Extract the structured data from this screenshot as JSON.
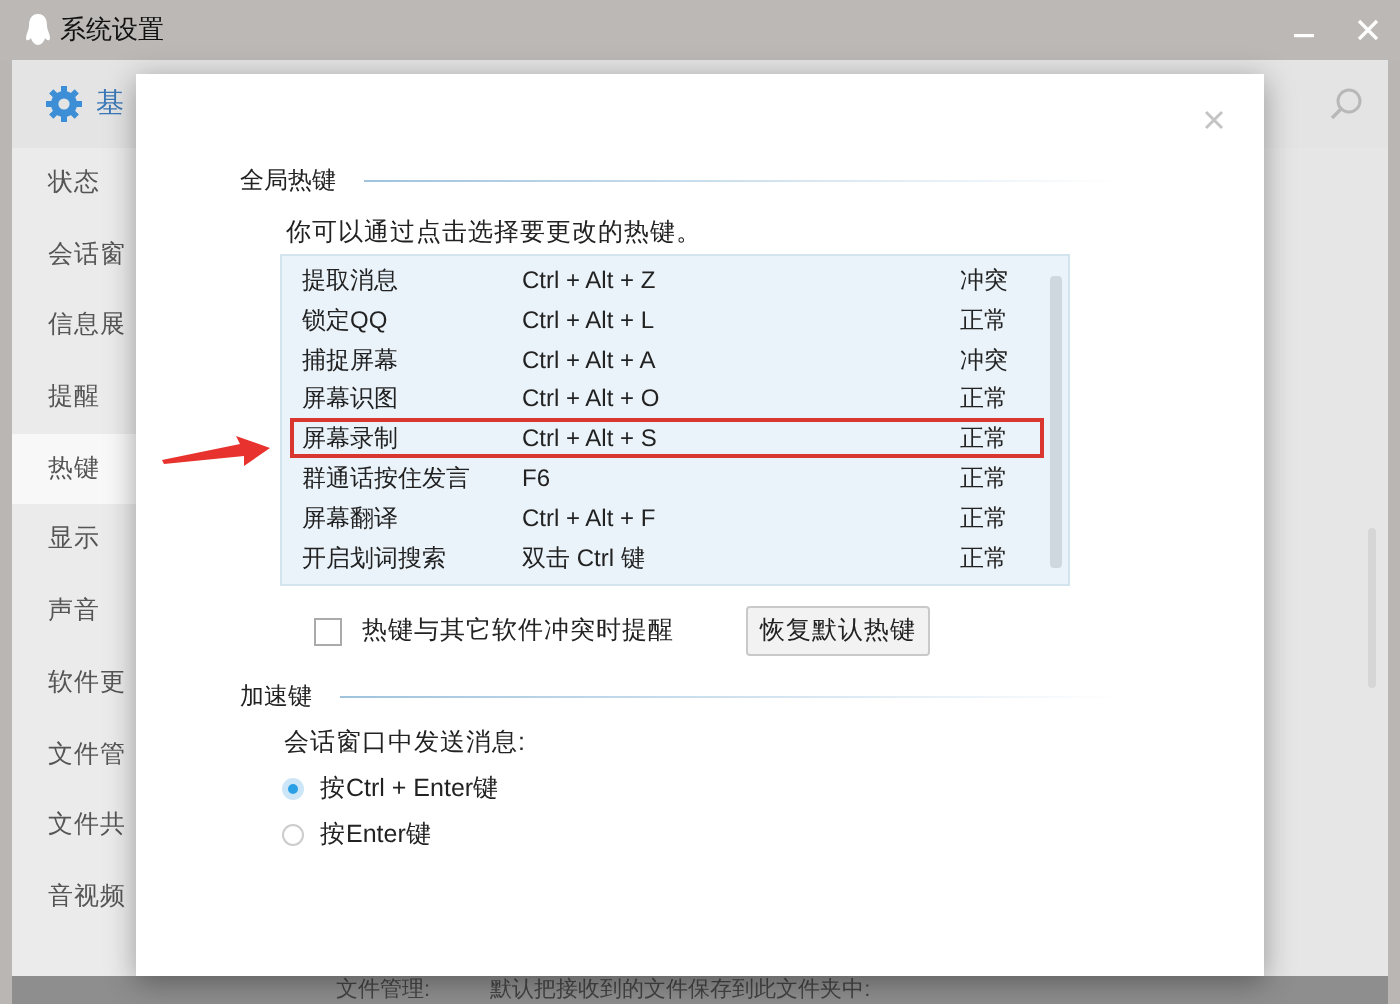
{
  "window": {
    "title": "系统设置"
  },
  "header": {
    "title": "基"
  },
  "sidebar": {
    "items": [
      {
        "label": "状态",
        "selected": false
      },
      {
        "label": "会话窗",
        "selected": false
      },
      {
        "label": "信息展",
        "selected": false
      },
      {
        "label": "提醒",
        "selected": false
      },
      {
        "label": "热键",
        "selected": true
      },
      {
        "label": "显示",
        "selected": false
      },
      {
        "label": "声音",
        "selected": false
      },
      {
        "label": "软件更",
        "selected": false
      },
      {
        "label": "文件管",
        "selected": false
      },
      {
        "label": "文件共",
        "selected": false
      },
      {
        "label": "音视频",
        "selected": false
      }
    ]
  },
  "background_footer": {
    "label": "文件管理:",
    "text": "默认把接收到的文件保存到此文件夹中:"
  },
  "dialog": {
    "global_hotkeys": {
      "title": "全局热键",
      "hint": "你可以通过点击选择要更改的热键。",
      "rows": [
        {
          "name": "提取消息",
          "keys": "Ctrl + Alt + Z",
          "status": "冲突",
          "highlighted": false
        },
        {
          "name": "锁定QQ",
          "keys": "Ctrl + Alt + L",
          "status": "正常",
          "highlighted": false
        },
        {
          "name": "捕捉屏幕",
          "keys": "Ctrl + Alt + A",
          "status": "冲突",
          "highlighted": false
        },
        {
          "name": "屏幕识图",
          "keys": "Ctrl + Alt + O",
          "status": "正常",
          "highlighted": false
        },
        {
          "name": "屏幕录制",
          "keys": "Ctrl + Alt + S",
          "status": "正常",
          "highlighted": true
        },
        {
          "name": "群通话按住发言",
          "keys": "F6",
          "status": "正常",
          "highlighted": false
        },
        {
          "name": "屏幕翻译",
          "keys": "Ctrl + Alt + F",
          "status": "正常",
          "highlighted": false
        },
        {
          "name": "开启划词搜索",
          "keys": "双击 Ctrl 键",
          "status": "正常",
          "highlighted": false
        }
      ],
      "conflict_alert": {
        "label": "热键与其它软件冲突时提醒",
        "checked": false
      },
      "restore_button": "恢复默认热键"
    },
    "accelerators": {
      "title": "加速键",
      "prompt": "会话窗口中发送消息:",
      "options": [
        {
          "label": "按Ctrl + Enter键",
          "selected": true
        },
        {
          "label": "按Enter键",
          "selected": false
        }
      ]
    }
  }
}
